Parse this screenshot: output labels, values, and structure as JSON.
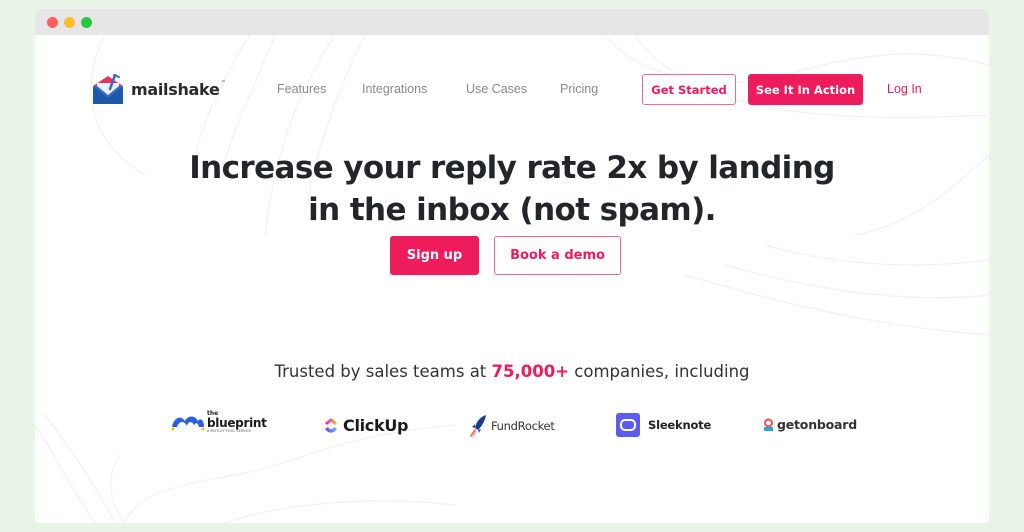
{
  "window": {
    "controls": [
      "close",
      "minimize",
      "maximize"
    ]
  },
  "header": {
    "logo_text": "mailshake",
    "logo_tm": "™",
    "nav": [
      {
        "label": "Features"
      },
      {
        "label": "Integrations"
      },
      {
        "label": "Use Cases"
      },
      {
        "label": "Pricing"
      }
    ],
    "get_started_label": "Get Started",
    "see_in_action_label": "See It In Action",
    "login_label": "Log In"
  },
  "hero": {
    "headline_line1": "Increase your reply rate 2x by landing",
    "headline_line2": "in the inbox (not spam).",
    "signup_label": "Sign up",
    "demo_label": "Book a demo"
  },
  "trusted": {
    "prefix": "Trusted by sales teams at ",
    "count": "75,000+",
    "suffix": " companies, including"
  },
  "brands": [
    {
      "name": "blueprint",
      "small_top": "the",
      "subtitle": "A MOTLEY FOOL SERVICE"
    },
    {
      "name": "ClickUp"
    },
    {
      "name": "FundRocket"
    },
    {
      "name": "Sleeknote"
    },
    {
      "name": "getonboard"
    }
  ],
  "colors": {
    "accent": "#ee1c5d",
    "page_bg": "#e8f4e6",
    "titlebar": "#e6e6e6",
    "heading": "#222529",
    "nav_text": "#8a8a8a"
  }
}
